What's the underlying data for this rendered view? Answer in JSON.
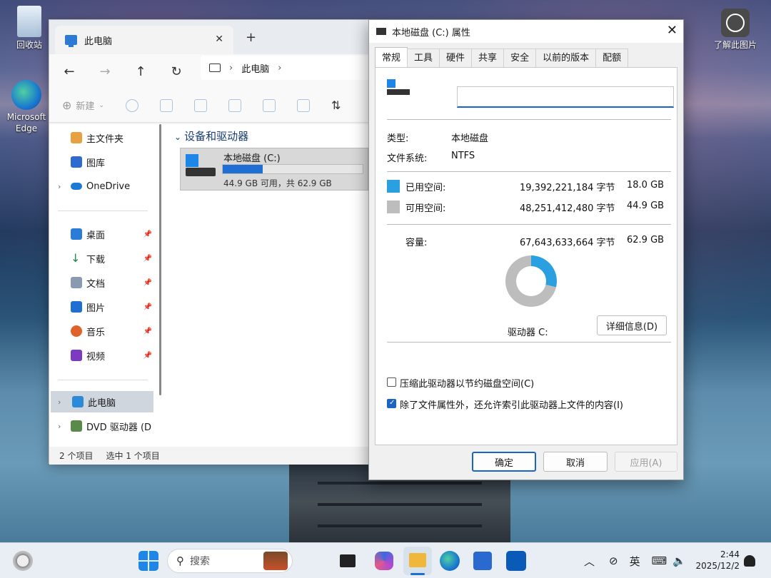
{
  "desktop": {
    "recycle_label": "回收站",
    "edge_label": "Microsoft Edge",
    "learn_label": "了解此图片"
  },
  "explorer": {
    "tab_title": "此电脑",
    "breadcrumb": "此电脑",
    "cmd_new": "新建",
    "group_title": "设备和驱动器",
    "nav": {
      "home": "主文件夹",
      "gallery": "图库",
      "onedrive": "OneDrive",
      "desktop": "桌面",
      "downloads": "下载",
      "documents": "文档",
      "pictures": "图片",
      "music": "音乐",
      "videos": "视频",
      "thispc": "此电脑",
      "dvd": "DVD 驱动器 (D"
    },
    "drive": {
      "name": "本地磁盘 (C:)",
      "free_text": "44.9 GB 可用，共 62.9 GB",
      "used_fraction": 0.287
    },
    "status": {
      "count": "2 个项目",
      "selected": "选中 1 个项目"
    }
  },
  "dialog": {
    "title": "本地磁盘 (C:) 属性",
    "tabs": [
      "常规",
      "工具",
      "硬件",
      "共享",
      "安全",
      "以前的版本",
      "配额"
    ],
    "name_value": "",
    "type_label": "类型:",
    "type_value": "本地磁盘",
    "fs_label": "文件系统:",
    "fs_value": "NTFS",
    "used_label": "已用空间:",
    "used_bytes": "19,392,221,184 字节",
    "used_gb": "18.0 GB",
    "free_label": "可用空间:",
    "free_bytes": "48,251,412,480 字节",
    "free_gb": "44.9 GB",
    "cap_label": "容量:",
    "cap_bytes": "67,643,633,664 字节",
    "cap_gb": "62.9 GB",
    "drive_label": "驱动器 C:",
    "details_btn": "详细信息(D)",
    "compress_label": "压缩此驱动器以节约磁盘空间(C)",
    "compress_checked": false,
    "index_label": "除了文件属性外，还允许索引此驱动器上文件的内容(I)",
    "index_checked": true,
    "ok": "确定",
    "cancel": "取消",
    "apply": "应用(A)",
    "colors": {
      "used": "#2ba0e0",
      "free": "#bdbdbd"
    }
  },
  "taskbar": {
    "search_placeholder": "搜索",
    "ime": "英",
    "time": "2:44",
    "date": "2025/12/2"
  }
}
